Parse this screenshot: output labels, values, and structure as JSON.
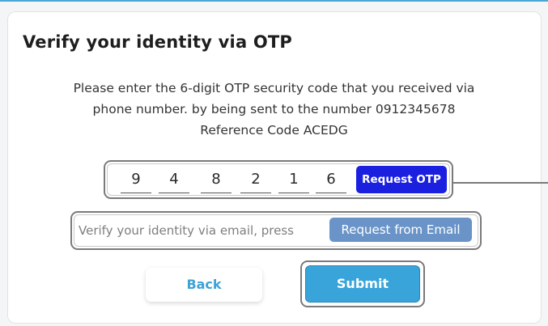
{
  "title": "Verify your identity via OTP",
  "description": {
    "line1": "Please enter the 6-digit OTP security code that you received via",
    "line2": "phone number. by being sent to the number 0912345678",
    "line3": "Reference Code ACEDG"
  },
  "otp": {
    "digits": [
      "9",
      "4",
      "8",
      "2",
      "1",
      "6"
    ],
    "request_label": "Request OTP"
  },
  "email": {
    "text": "Verify your identity via email, press",
    "request_label": "Request from Email"
  },
  "buttons": {
    "back_label": "Back",
    "submit_label": "Submit"
  },
  "colors": {
    "accent": "#38a4da",
    "request_otp": "#1a1fe0",
    "request_email": "#6a94c8"
  }
}
